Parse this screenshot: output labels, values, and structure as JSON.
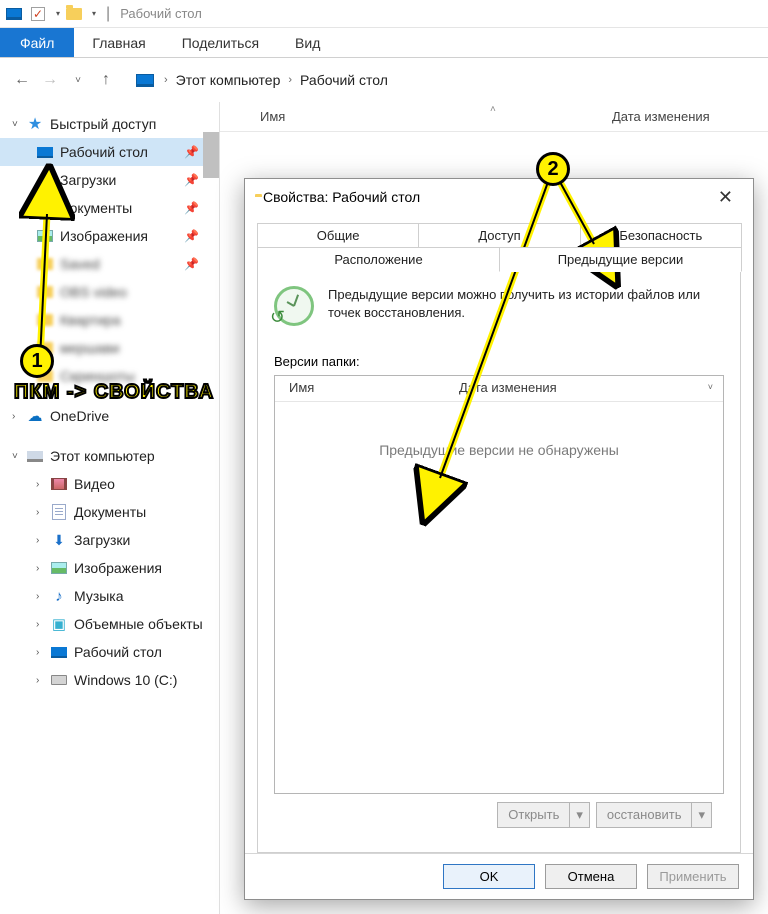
{
  "titlebar": {
    "title": "Рабочий стол"
  },
  "ribbon": {
    "file": "Файл",
    "tabs": [
      "Главная",
      "Поделиться",
      "Вид"
    ]
  },
  "breadcrumb": {
    "root": "Этот компьютер",
    "current": "Рабочий стол"
  },
  "columns": {
    "name": "Имя",
    "modified": "Дата изменения"
  },
  "sidebar": {
    "quick": "Быстрый доступ",
    "quick_items": [
      {
        "label": "Рабочий стол",
        "pinned": true,
        "selected": true,
        "icon": "monitor"
      },
      {
        "label": "Загрузки",
        "pinned": true,
        "icon": "download"
      },
      {
        "label": "Документы",
        "pinned": true,
        "icon": "doc"
      },
      {
        "label": "Изображения",
        "pinned": true,
        "icon": "image"
      }
    ],
    "onedrive": "OneDrive",
    "this_pc": "Этот компьютер",
    "pc_items": [
      {
        "label": "Видео",
        "icon": "video"
      },
      {
        "label": "Документы",
        "icon": "doc"
      },
      {
        "label": "Загрузки",
        "icon": "download"
      },
      {
        "label": "Изображения",
        "icon": "image"
      },
      {
        "label": "Музыка",
        "icon": "music"
      },
      {
        "label": "Объемные объекты",
        "icon": "cube"
      },
      {
        "label": "Рабочий стол",
        "icon": "monitor"
      },
      {
        "label": "Windows 10 (C:)",
        "icon": "drive"
      }
    ]
  },
  "dialog": {
    "title": "Свойства: Рабочий стол",
    "tabs_row1": [
      "Общие",
      "Доступ",
      "Безопасность"
    ],
    "tabs_row2": [
      "Расположение",
      "Предыдущие версии"
    ],
    "description": "Предыдущие версии можно получить из истории файлов или точек восстановления.",
    "versions_label": "Версии папки:",
    "versions_cols": {
      "name": "Имя",
      "modified": "Дата изменения"
    },
    "versions_empty": "Предыдущие версии не обнаружены",
    "action_open": "Открыть",
    "action_restore": "осстановить",
    "ok": "OK",
    "cancel": "Отмена",
    "apply": "Применить"
  },
  "annotations": {
    "step1": "1",
    "step2": "2",
    "hint": "ПКМ -> СВОЙСТВА"
  }
}
